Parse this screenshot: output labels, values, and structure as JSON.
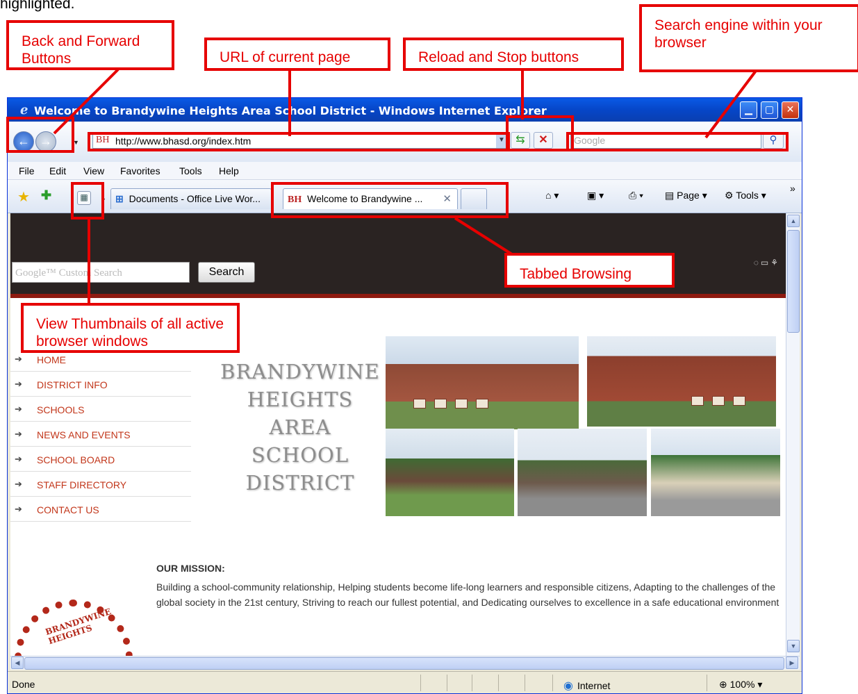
{
  "intro_text": "highlighted.",
  "callouts": {
    "back_forward": "Back and Forward Buttons",
    "url": "URL of current page",
    "reload_stop": "Reload and Stop buttons",
    "search_engine": "Search engine within your browser",
    "tabbed": "Tabbed Browsing",
    "thumbnails": "View Thumbnails of all active browser windows"
  },
  "window": {
    "title": "Welcome to Brandywine Heights Area School District - Windows Internet Explorer",
    "address_url": "http://www.bhasd.org/index.htm",
    "address_favicon": "BH",
    "search_placeholder": "Google",
    "menu": [
      "File",
      "Edit",
      "View",
      "Favorites",
      "Tools",
      "Help"
    ],
    "tabs": [
      {
        "label": "Documents - Office Live Wor..."
      },
      {
        "label": "Welcome to Brandywine ..."
      }
    ],
    "commands": {
      "page": "Page",
      "tools": "Tools"
    },
    "status_text": "Done",
    "zone": "Internet",
    "zoom": "100%"
  },
  "site": {
    "search_hint": "Google™ Custom Search",
    "search_button": "Search",
    "nav": [
      "HOME",
      "DISTRICT INFO",
      "SCHOOLS",
      "NEWS AND EVENTS",
      "SCHOOL BOARD",
      "STAFF DIRECTORY",
      "CONTACT US"
    ],
    "name_lines": [
      "BRANDYWINE",
      "HEIGHTS",
      "AREA",
      "SCHOOL",
      "DISTRICT"
    ],
    "mission_heading": "OUR MISSION:",
    "mission_text": "Building a school-community relationship, Helping students become life-long learners and responsible citizens, Adapting to the challenges of the global society in the 21st century, Striving to reach our fullest potential, and Dedicating ourselves to excellence in a safe educational environment",
    "seal_text": "BRANDYWINE HEIGHTS"
  },
  "colors": {
    "annotation_red": "#e60000",
    "xp_blue": "#0a5ae6",
    "nav_red": "#c2361a"
  }
}
